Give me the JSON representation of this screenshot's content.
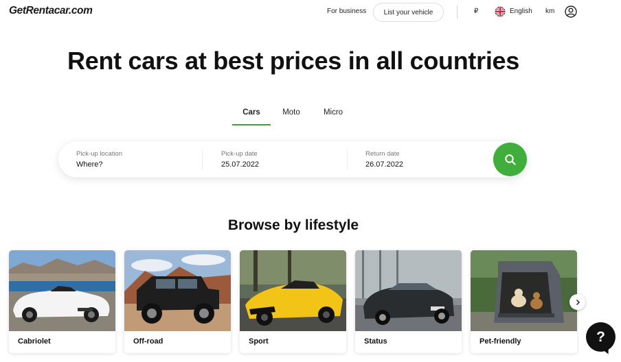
{
  "header": {
    "logo": "GetRentacar.com",
    "for_business": "For business",
    "list_vehicle": "List your vehicle",
    "currency": "₽",
    "language": "English",
    "unit": "km"
  },
  "hero": {
    "title": "Rent cars at best prices in all countries"
  },
  "tabs": [
    {
      "label": "Cars",
      "active": true
    },
    {
      "label": "Moto",
      "active": false
    },
    {
      "label": "Micro",
      "active": false
    }
  ],
  "search": {
    "pickup_location_label": "Pick-up location",
    "pickup_location_placeholder": "Where?",
    "pickup_date_label": "Pick-up date",
    "pickup_date_value": "25.07.2022",
    "return_date_label": "Return date",
    "return_date_value": "26.07.2022"
  },
  "lifestyle": {
    "title": "Browse by lifestyle",
    "cards": [
      {
        "label": "Cabriolet"
      },
      {
        "label": "Off-road"
      },
      {
        "label": "Sport"
      },
      {
        "label": "Status"
      },
      {
        "label": "Pet-friendly"
      }
    ]
  },
  "help": {
    "label": "?"
  },
  "colors": {
    "accent": "#3fae3a",
    "text": "#111111",
    "help_button": "#111111"
  },
  "icons": [
    "flag-uk-icon",
    "user-icon",
    "search-icon",
    "chevron-right-icon",
    "help-icon"
  ]
}
